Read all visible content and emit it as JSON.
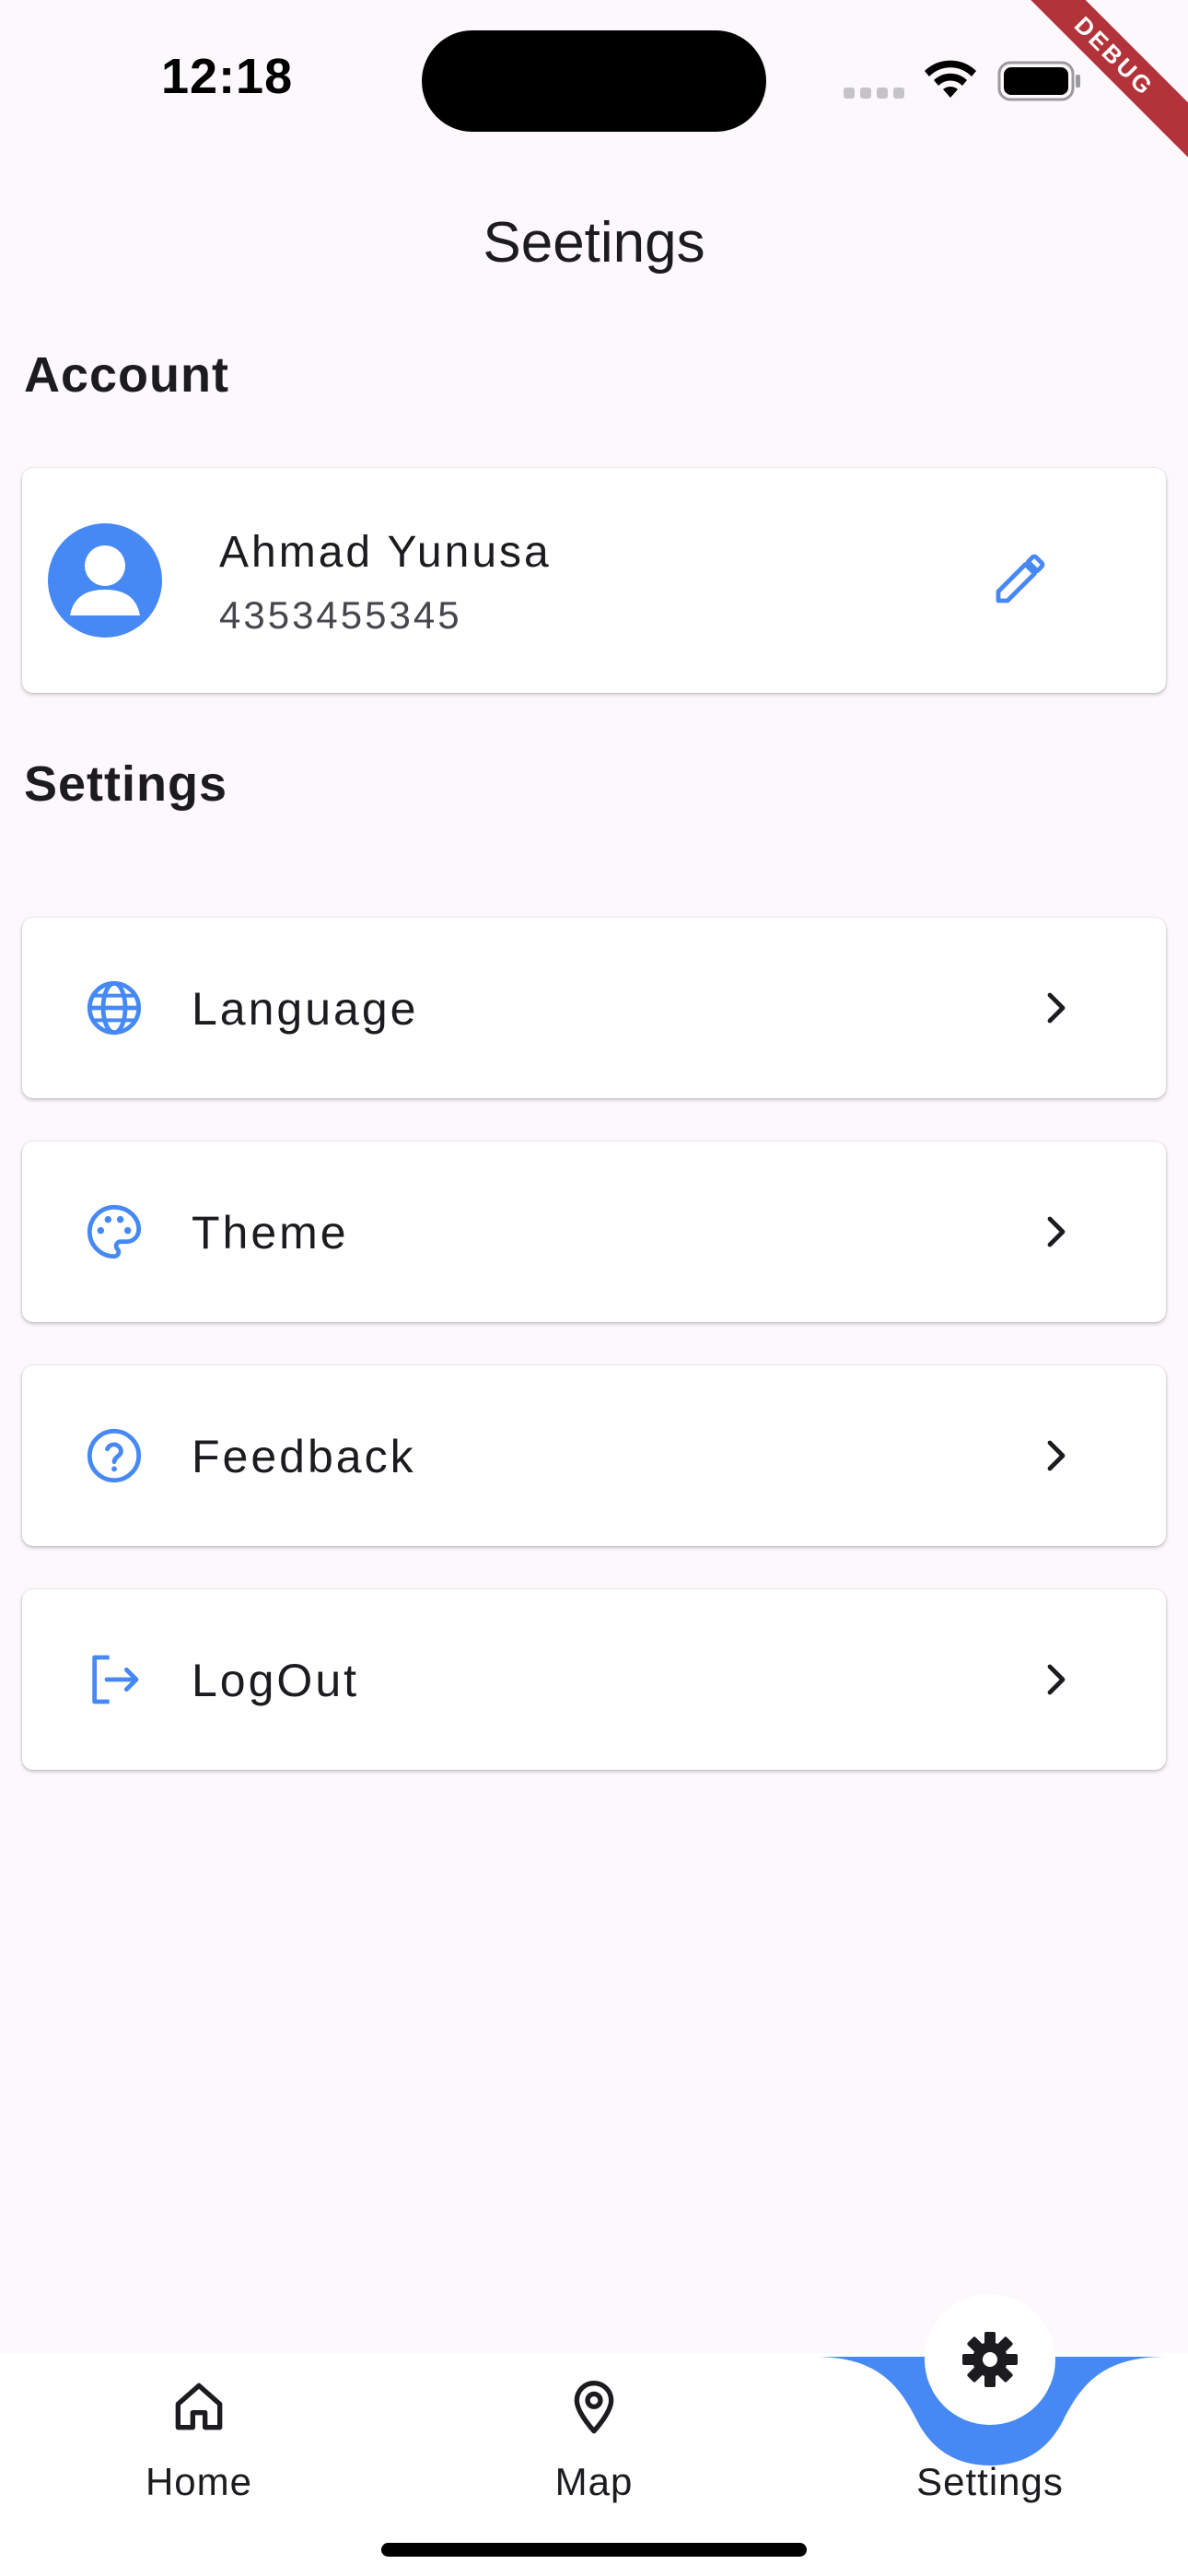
{
  "status_bar": {
    "time": "12:18"
  },
  "debug_banner": "DEBUG",
  "page_title": "Seetings",
  "account_section": {
    "heading": "Account",
    "name": "Ahmad Yunusa",
    "phone": "4353455345"
  },
  "settings_section": {
    "heading": "Settings",
    "items": [
      {
        "label": "Language",
        "icon": "globe-icon"
      },
      {
        "label": "Theme",
        "icon": "palette-icon"
      },
      {
        "label": "Feedback",
        "icon": "help-circle-icon"
      },
      {
        "label": "LogOut",
        "icon": "logout-icon"
      }
    ]
  },
  "bottom_nav": {
    "items": [
      {
        "label": "Home",
        "icon": "home-icon"
      },
      {
        "label": "Map",
        "icon": "map-pin-icon"
      },
      {
        "label": "Settings",
        "icon": "gear-icon",
        "active": true
      }
    ]
  },
  "colors": {
    "accent": "#4688f4",
    "background": "#fcf8fc",
    "debug": "#b3333a"
  }
}
